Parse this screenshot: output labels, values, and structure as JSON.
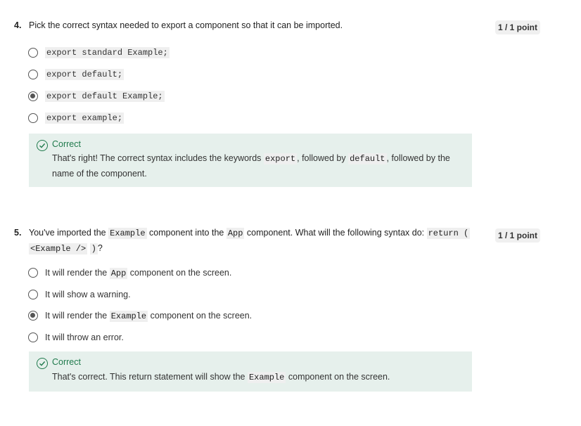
{
  "q4": {
    "number": "4.",
    "prompt": "Pick the correct syntax needed to export a component so that it can be imported.",
    "points": "1 / 1 point",
    "options": [
      {
        "label": "export standard Example;",
        "selected": false
      },
      {
        "label": "export default;",
        "selected": false
      },
      {
        "label": "export default Example;",
        "selected": true
      },
      {
        "label": "export example;",
        "selected": false
      }
    ],
    "feedback": {
      "title": "Correct",
      "text_a": "That's right! The correct syntax includes the keywords ",
      "code_a": "export",
      "text_b": ", followed by ",
      "code_b": "default",
      "text_c": ", followed by the",
      "text_d": "name of the component."
    }
  },
  "q5": {
    "number": "5.",
    "prompt_a": "You've imported the ",
    "code_a": "Example",
    "prompt_b": " component into the ",
    "code_b": "App",
    "prompt_c": " component. What will the following syntax do: ",
    "code_c": "return (",
    "code_d": "<Example />",
    "code_e": ")",
    "prompt_d": "?",
    "points": "1 / 1 point",
    "options": [
      {
        "pre": "It will render the ",
        "code": "App",
        "post": " component on the screen.",
        "selected": false
      },
      {
        "pre": "It will show a warning.",
        "code": "",
        "post": "",
        "selected": false
      },
      {
        "pre": "It will render the ",
        "code": "Example",
        "post": " component on the screen.",
        "selected": true
      },
      {
        "pre": "It will throw an error.",
        "code": "",
        "post": "",
        "selected": false
      }
    ],
    "feedback": {
      "title": "Correct",
      "text_a": "That's correct. This return statement will show the ",
      "code_a": "Example",
      "text_b": " component on the screen."
    }
  },
  "colors": {
    "correct_green": "#1f7a4c",
    "feedback_bg": "#e6f0ec"
  }
}
